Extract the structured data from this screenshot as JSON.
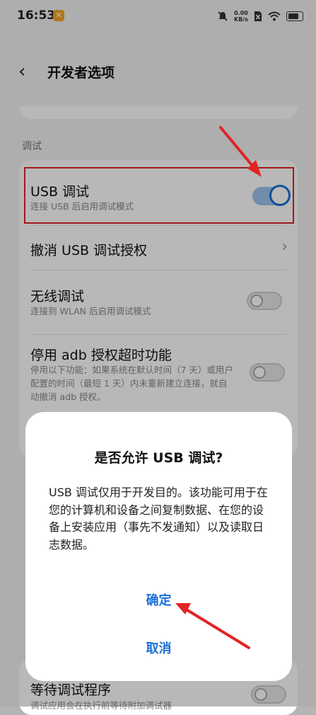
{
  "status_bar": {
    "time": "16:53",
    "net_speed_value": "0.00",
    "net_speed_unit": "KB/s"
  },
  "header": {
    "title": "开发者选项"
  },
  "section": {
    "label": "调试"
  },
  "settings": [
    {
      "title": "USB 调试",
      "subtitle": "连接 USB 后启用调试模式",
      "control": "toggle",
      "enabled": true
    },
    {
      "title": "撤消 USB 调试授权",
      "control": "chevron"
    },
    {
      "title": "无线调试",
      "subtitle": "连接到 WLAN 后启用调试模式",
      "control": "toggle",
      "enabled": false
    },
    {
      "title": "停用 adb 授权超时功能",
      "subtitle": "停用以下功能：如果系统在默认时间（7 天）或用户配置的时间（最短 1 天）内未重新建立连接，就自动撤消 adb 授权。",
      "control": "toggle",
      "enabled": false
    }
  ],
  "lower": {
    "title": "等待调试程序",
    "subtitle": "调试应用会在执行前等待附加调试器"
  },
  "dialog": {
    "title": "是否允许 USB 调试?",
    "body": "USB 调试仅用于开发目的。该功能可用于在您的计算机和设备之间复制数据、在您的设备上安装应用（事先不发通知）以及读取日志数据。",
    "confirm": "确定",
    "cancel": "取消"
  },
  "colors": {
    "accent": "#1a6fd6",
    "annotation": "#e02424"
  }
}
